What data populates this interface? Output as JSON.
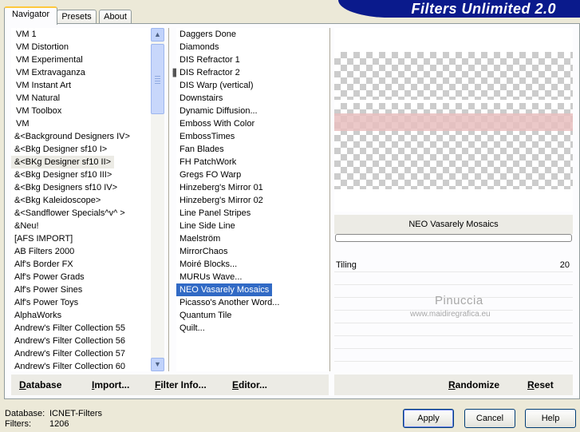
{
  "app_title": "Filters Unlimited 2.0",
  "tabs": [
    {
      "label": "Navigator"
    },
    {
      "label": "Presets"
    },
    {
      "label": "About"
    }
  ],
  "categories": [
    "VM 1",
    "VM Distortion",
    "VM Experimental",
    "VM Extravaganza",
    "VM Instant Art",
    "VM Natural",
    "VM Toolbox",
    "VM",
    "&<Background Designers IV>",
    "&<Bkg Designer sf10 I>",
    "&<BKg Designer sf10 II>",
    "&<Bkg Designer sf10 III>",
    "&<Bkg Designers sf10 IV>",
    "&<Bkg Kaleidoscope>",
    "&<Sandflower Specials^v^ >",
    "&Neu!",
    "[AFS IMPORT]",
    "AB Filters 2000",
    "Alf's Border FX",
    "Alf's Power Grads",
    "Alf's Power Sines",
    "Alf's Power Toys",
    "AlphaWorks",
    "Andrew's Filter Collection 55",
    "Andrew's Filter Collection 56",
    "Andrew's Filter Collection 57",
    "Andrew's Filter Collection 60"
  ],
  "filters": [
    "Daggers Done",
    "Diamonds",
    "DIS Refractor 1",
    "DIS Refractor 2",
    "DIS Warp (vertical)",
    "Downstairs",
    "Dynamic Diffusion...",
    "Emboss With Color",
    "EmbossTimes",
    "Fan Blades",
    "FH PatchWork",
    "Gregs FO Warp",
    "Hinzeberg's Mirror 01",
    "Hinzeberg's Mirror 02",
    "Line Panel Stripes",
    "Line Side Line",
    "Maelström",
    "MirrorChaos",
    "Moiré Blocks...",
    "MURUs Wave...",
    "NEO Vasarely Mosaics",
    "Picasso's Another Word...",
    "Quantum Tile",
    "Quilt..."
  ],
  "selected_category": "&<BKg Designer sf10 II>",
  "selected_filter": "NEO Vasarely Mosaics",
  "filter_name": "NEO Vasarely Mosaics",
  "params": [
    {
      "label": "Tiling",
      "value": "20"
    }
  ],
  "watermark": {
    "line1": "Pinuccia",
    "line2": "www.maidiregrafica.eu"
  },
  "bar_buttons": {
    "database": "Database",
    "import": "Import...",
    "filter_info": "Filter Info...",
    "editor": "Editor...",
    "randomize": "Randomize",
    "reset": "Reset"
  },
  "status": {
    "database_label": "Database:",
    "database_value": "ICNET-Filters",
    "filters_label": "Filters:",
    "filters_value": "1206"
  },
  "buttons": {
    "apply": "Apply",
    "cancel": "Cancel",
    "help": "Help"
  },
  "colors": {
    "banner": "#0a1a8c",
    "selection": "#316ac5",
    "tab_highlight": "#ffc83c"
  }
}
